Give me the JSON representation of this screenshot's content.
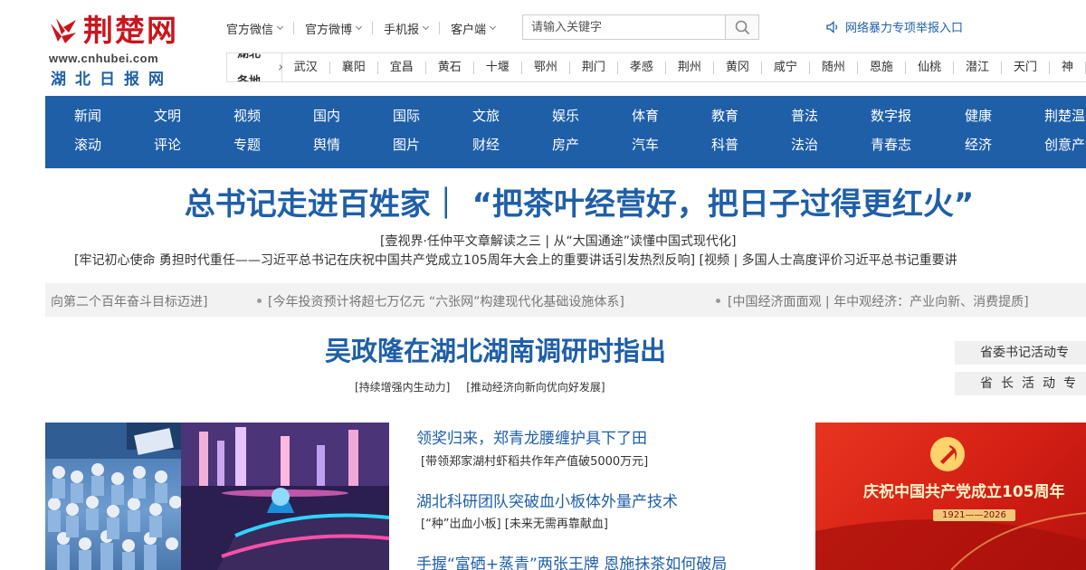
{
  "site": {
    "logo_title": "荆楚网",
    "logo_url": "www.cnhubei.com",
    "logo_name": "湖北日报网"
  },
  "top_links": [
    {
      "label": "官方微信"
    },
    {
      "label": "官方微博"
    },
    {
      "label": "手机报"
    },
    {
      "label": "客户端"
    }
  ],
  "search": {
    "placeholder": "请输入关键字"
  },
  "report_link": "网络暴力专项举报入口",
  "regions": {
    "title": "湖北各地",
    "items": [
      "武汉",
      "襄阳",
      "宜昌",
      "黄石",
      "十堰",
      "鄂州",
      "荆门",
      "孝感",
      "荆州",
      "黄冈",
      "咸宁",
      "随州",
      "恩施",
      "仙桃",
      "潜江",
      "天门",
      "神"
    ]
  },
  "nav": [
    {
      "top": "新闻",
      "bottom": "滚动"
    },
    {
      "top": "文明",
      "bottom": "评论"
    },
    {
      "top": "视频",
      "bottom": "专题"
    },
    {
      "top": "国内",
      "bottom": "舆情"
    },
    {
      "top": "国际",
      "bottom": "图片"
    },
    {
      "top": "文旅",
      "bottom": "财经"
    },
    {
      "top": "娱乐",
      "bottom": "房产"
    },
    {
      "top": "体育",
      "bottom": "汽车"
    },
    {
      "top": "教育",
      "bottom": "科普"
    },
    {
      "top": "普法",
      "bottom": "法治"
    },
    {
      "top": "数字报",
      "bottom": "青春志"
    },
    {
      "top": "健康",
      "bottom": "经济"
    },
    {
      "top": "荆楚温",
      "bottom": "创意产"
    }
  ],
  "headline": {
    "main": "总书记走进百姓家｜ “把茶叶经营好，把日子过得更红火”",
    "sub1": "[壹视界·任仲平文章解读之三 | 从“大国通途”读懂中国式现代化]",
    "sub2_a": "[牢记初心使命 勇担时代重任——习近平总书记在庆祝中国共产党成立105周年大会上的重要讲话引发热烈反响]",
    "sub2_b": "[视频 | 多国人士高度评价习近平总书记重要讲"
  },
  "ticker": [
    "向第二个百年奋斗目标迈进]",
    "[今年投资预计将超七万亿元 “六张网”构建现代化基础设施体系]",
    "[中国经济面面观 | 年中观经济：产业向新、消费提质]"
  ],
  "headline2": {
    "main": "吴政隆在湖北湖南调研时指出",
    "subs": [
      "[持续增强内生动力]",
      "[推动经济向新向优向好发展]"
    ]
  },
  "side_tabs": [
    "省委书记活动专",
    "省长活动专"
  ],
  "news": [
    {
      "title": "领奖归来，郑青龙腰缠护具下了田",
      "subs": [
        "[带领郑家湖村虾稻共作年产值破5000万元]"
      ]
    },
    {
      "title": "湖北科研团队突破血小板体外量产技术",
      "subs": [
        "[“种”出血小板]",
        "[未来无需再靠献血]"
      ]
    },
    {
      "title": "手握“富硒+蒸青”两张王牌 恩施抹茶如何破局",
      "subs": []
    }
  ],
  "banner": {
    "text": "庆祝中国共产党成立105周年",
    "years": "1921——2026"
  },
  "colors": {
    "brand_blue": "#1f5fa8",
    "logo_red": "#c8161d",
    "banner_red": "#d41f15"
  }
}
